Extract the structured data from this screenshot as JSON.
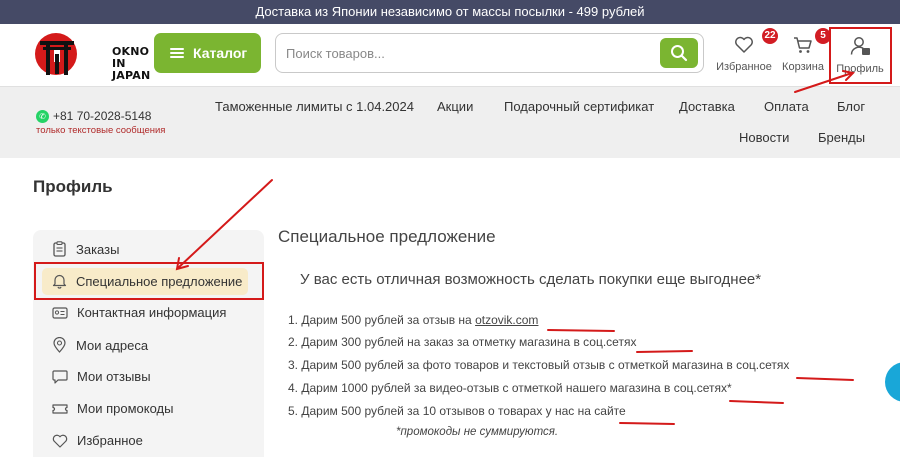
{
  "topbar": {
    "text": "Доставка из Японии независимо от массы посылки - 499 рублей"
  },
  "header": {
    "logo_text_1": "OKNO IN",
    "logo_text_2": "JAPAN",
    "catalog_label": "Каталог",
    "search_placeholder": "Поиск товаров...",
    "favorites": {
      "label": "Избранное",
      "count": "22"
    },
    "cart": {
      "label": "Корзина",
      "count": "5"
    },
    "profile": {
      "label": "Профиль"
    }
  },
  "nav": {
    "phone": "+81 70-2028-5148",
    "phone_note": "только текстовые сообщения",
    "links": [
      "Таможенные лимиты с 1.04.2024",
      "Акции",
      "Подарочный сертификат",
      "Доставка",
      "Оплата",
      "Блог",
      "Новости",
      "Бренды"
    ]
  },
  "page": {
    "title": "Профиль"
  },
  "sidebar": {
    "items": [
      {
        "label": "Заказы",
        "icon": "orders-icon"
      },
      {
        "label": "Специальное предложение",
        "icon": "bell-icon",
        "active": true
      },
      {
        "label": "Контактная информация",
        "icon": "id-card-icon"
      },
      {
        "label": "Мои адреса",
        "icon": "location-pin-icon"
      },
      {
        "label": "Мои отзывы",
        "icon": "chat-bubble-icon"
      },
      {
        "label": "Мои промокоды",
        "icon": "ticket-icon"
      },
      {
        "label": "Избранное",
        "icon": "heart-icon"
      }
    ]
  },
  "offer": {
    "title": "Специальное предложение",
    "lead": "У вас есть отличная возможность сделать покупки еще выгоднее*",
    "items": [
      {
        "prefix": "1. Дарим 500 рублей за отзыв на ",
        "link": "otzovik.com",
        "suffix": ""
      },
      {
        "prefix": "2. Дарим 300 рублей на заказ за отметку магазина в соц.сетях",
        "link": "",
        "suffix": ""
      },
      {
        "prefix": "3. Дарим 500 рублей за фото товаров и текстовый отзыв с отметкой магазина в соц.сетях",
        "link": "",
        "suffix": ""
      },
      {
        "prefix": "4. Дарим 1000 рублей за видео-отзыв с отметкой нашего магазина в соц.сетях*",
        "link": "",
        "suffix": ""
      },
      {
        "prefix": "5. Дарим 500 рублей за 10 отзывов о товарах у нас на сайте",
        "link": "",
        "suffix": ""
      }
    ],
    "note": "*промокоды не суммируются."
  },
  "colors": {
    "accent_green": "#7bb531",
    "topbar_bg": "#454a66",
    "annotation_red": "#d41a1a",
    "badge_red": "#d21d24"
  }
}
